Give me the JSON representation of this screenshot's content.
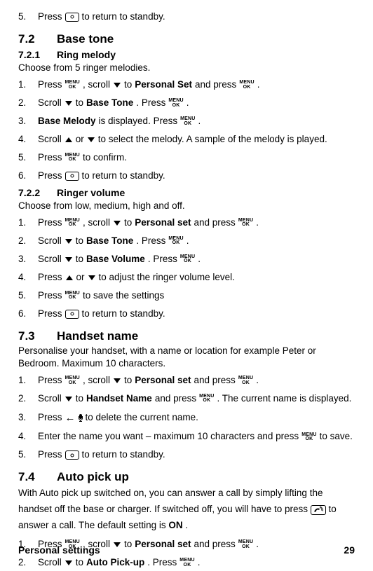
{
  "top_step": {
    "num": "5.",
    "a": "Press",
    "b": "to return to standby."
  },
  "s72": {
    "num": "7.2",
    "title": "Base tone",
    "s721": {
      "num": "7.2.1",
      "title": "Ring melody",
      "intro": "Choose from 5 ringer melodies.",
      "steps": [
        {
          "num": "1.",
          "parts": [
            "Press",
            "{menuok}",
            ", scroll",
            "{down}",
            "to",
            "{b}Personal Set",
            "and press",
            "{menuok}",
            "."
          ]
        },
        {
          "num": "2.",
          "parts": [
            "Scroll",
            "{down}",
            "to",
            "{b}Base Tone",
            ". Press",
            "{menuok}",
            "."
          ]
        },
        {
          "num": "3.",
          "parts": [
            "{b}Base Melody",
            "is displayed. Press",
            "{menuok}",
            "."
          ]
        },
        {
          "num": "4.",
          "parts": [
            "Scroll",
            "{up}",
            "or",
            "{down}",
            "to select the melody. A sample of the melody is played."
          ]
        },
        {
          "num": "5.",
          "parts": [
            "Press",
            "{menuok}",
            "to confirm."
          ]
        },
        {
          "num": "6.",
          "parts": [
            "Press",
            "{standby}",
            "to return to standby."
          ]
        }
      ]
    },
    "s722": {
      "num": "7.2.2",
      "title": "Ringer volume",
      "intro": "Choose from low, medium, high and off.",
      "steps": [
        {
          "num": "1.",
          "parts": [
            "Press",
            "{menuok}",
            ", scroll",
            "{down}",
            "to",
            "{b}Personal set",
            "and press",
            "{menuok}",
            "."
          ]
        },
        {
          "num": "2.",
          "parts": [
            "Scroll",
            "{down}",
            "to",
            "{b}Base Tone",
            ". Press",
            "{menuok}",
            "."
          ]
        },
        {
          "num": "3.",
          "parts": [
            "Scroll",
            "{down}",
            "to",
            "{b}Base Volume",
            ". Press",
            "{menuok}",
            "."
          ]
        },
        {
          "num": "4.",
          "parts": [
            "Press",
            "{up}",
            "or",
            "{down}",
            "to adjust the ringer volume level."
          ]
        },
        {
          "num": "5.",
          "parts": [
            "Press",
            "{menuok}",
            "to save the settings"
          ]
        },
        {
          "num": "6.",
          "parts": [
            "Press",
            "{standby}",
            "to return to standby."
          ]
        }
      ]
    }
  },
  "s73": {
    "num": "7.3",
    "title": "Handset name",
    "intro": "Personalise your handset, with a name or location for example Peter or Bedroom. Maximum 10 characters.",
    "steps": [
      {
        "num": "1.",
        "parts": [
          "Press",
          "{menuok}",
          ", scroll",
          "{down}",
          "to",
          "{b}Personal set",
          "and press",
          "{menuok}",
          "."
        ]
      },
      {
        "num": "2.",
        "parts": [
          "Scroll",
          "{down}",
          "to",
          "{b}Handset Name",
          "and press",
          "{menuok}",
          ". The current name is displayed."
        ]
      },
      {
        "num": "3.",
        "parts": [
          "Press",
          "{left}",
          "{mic}",
          "to delete the current name."
        ]
      },
      {
        "num": "4.",
        "parts": [
          "Enter the name you want – maximum 10 characters and press",
          "{menuok}",
          "to save."
        ]
      },
      {
        "num": "5.",
        "parts": [
          "Press",
          "{standby}",
          "to return to standby."
        ]
      }
    ]
  },
  "s74": {
    "num": "7.4",
    "title": "Auto pick up",
    "intro_parts": [
      "With Auto pick up switched on, you can answer a call by simply lifting the handset off the base or charger. If switched off, you will have to press",
      "{call}",
      "to answer a call. The default setting is",
      "{b}ON",
      "."
    ],
    "steps": [
      {
        "num": "1.",
        "parts": [
          "Press",
          "{menuok}",
          ", scroll",
          "{down}",
          "to",
          "{b}Personal set",
          "and press",
          "{menuok}",
          "."
        ]
      },
      {
        "num": "2.",
        "parts": [
          "Scroll",
          "{down}",
          "to",
          "{b}Auto Pick-up",
          ". Press",
          "{menuok}",
          "."
        ]
      }
    ]
  },
  "footer": {
    "left": "Personal settings",
    "right": "29"
  }
}
